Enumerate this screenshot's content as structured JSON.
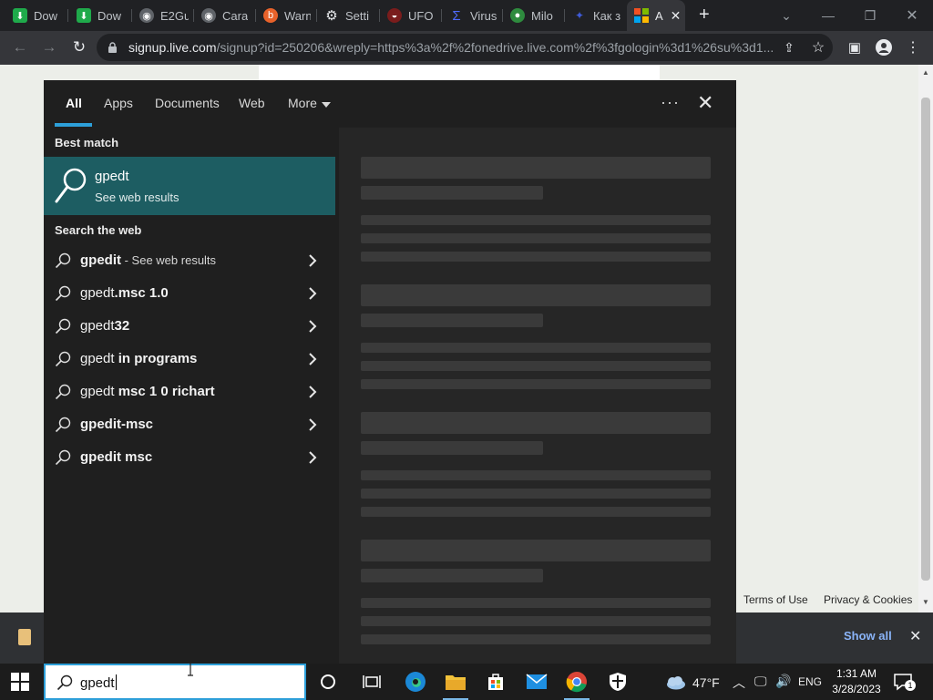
{
  "browser": {
    "tabs": [
      {
        "label": "Dow",
        "icon": "download-icon"
      },
      {
        "label": "Dow",
        "icon": "download-icon"
      },
      {
        "label": "E2Gu",
        "icon": "globe-icon"
      },
      {
        "label": "Cara",
        "icon": "globe-icon"
      },
      {
        "label": "Warn",
        "icon": "bitdefender-icon"
      },
      {
        "label": "Setti",
        "icon": "gear-icon"
      },
      {
        "label": "UFO",
        "icon": "ufo-icon"
      },
      {
        "label": "Virus",
        "icon": "sigma-icon"
      },
      {
        "label": "Milo",
        "icon": "pin-icon"
      },
      {
        "label": "Как з",
        "icon": "flag-icon"
      },
      {
        "label": "A",
        "icon": "microsoft-icon",
        "active": true
      }
    ],
    "new_tab": "+",
    "url_host": "signup.live.com",
    "url_path": "/signup?id=250206&wreply=https%3a%2f%2fonedrive.live.com%2f%3fgologin%3d1%26su%3d1..."
  },
  "page": {
    "footer_terms": "Terms of Use",
    "footer_privacy": "Privacy & Cookies",
    "download_show_all": "Show all"
  },
  "search": {
    "filters": [
      "All",
      "Apps",
      "Documents",
      "Web",
      "More"
    ],
    "best_match_heading": "Best match",
    "best_match": {
      "title": "gpedt",
      "subtitle": "See web results"
    },
    "web_heading": "Search the web",
    "suggestions": [
      {
        "plain": "",
        "bold": "gpedit",
        "note": " - See web results"
      },
      {
        "plain": "gpedt",
        "bold": ".msc 1.0",
        "note": ""
      },
      {
        "plain": "gpedt",
        "bold": "32",
        "note": ""
      },
      {
        "plain": "gpedt ",
        "bold": "in programs",
        "note": ""
      },
      {
        "plain": "gpedt ",
        "bold": "msc 1 0 richart",
        "note": ""
      },
      {
        "plain": "",
        "bold": "gpedit-msc",
        "note": ""
      },
      {
        "plain": "",
        "bold": "gpedit msc",
        "note": ""
      }
    ],
    "query": "gpedt"
  },
  "taskbar": {
    "weather": "47°F",
    "language": "ENG",
    "time": "1:31 AM",
    "date": "3/28/2023",
    "notification_count": "1"
  },
  "colors": {
    "accent": "#2d9fd9",
    "best_match_bg": "#1d5d62",
    "panel_bg": "#1f1f1f"
  }
}
